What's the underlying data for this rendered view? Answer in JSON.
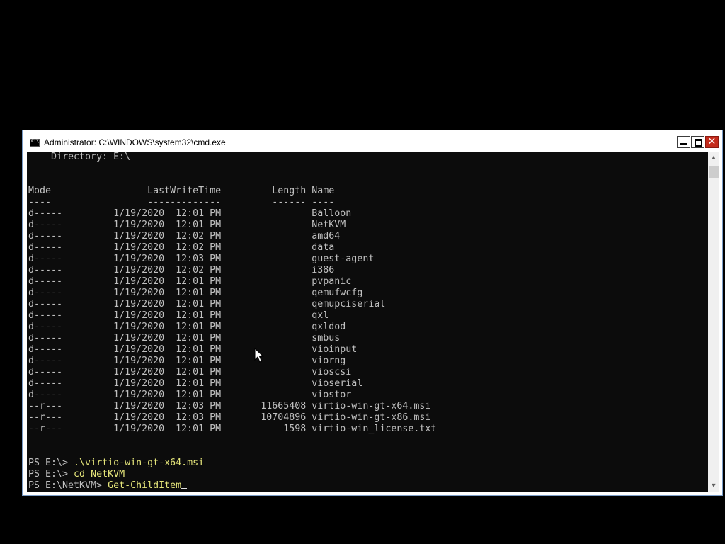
{
  "window": {
    "title": "Administrator: C:\\WINDOWS\\system32\\cmd.exe",
    "controls": {
      "minimize": "minimize",
      "maximize": "maximize",
      "close": "✕"
    }
  },
  "console": {
    "directory_header": "    Directory: E:\\",
    "columns_header": "Mode                 LastWriteTime         Length Name",
    "columns_rule": "----                 -------------         ------ ----",
    "entries": [
      "d-----         1/19/2020  12:01 PM                Balloon",
      "d-----         1/19/2020  12:01 PM                NetKVM",
      "d-----         1/19/2020  12:02 PM                amd64",
      "d-----         1/19/2020  12:02 PM                data",
      "d-----         1/19/2020  12:03 PM                guest-agent",
      "d-----         1/19/2020  12:02 PM                i386",
      "d-----         1/19/2020  12:01 PM                pvpanic",
      "d-----         1/19/2020  12:01 PM                qemufwcfg",
      "d-----         1/19/2020  12:01 PM                qemupciserial",
      "d-----         1/19/2020  12:01 PM                qxl",
      "d-----         1/19/2020  12:01 PM                qxldod",
      "d-----         1/19/2020  12:01 PM                smbus",
      "d-----         1/19/2020  12:01 PM                vioinput",
      "d-----         1/19/2020  12:01 PM                viorng",
      "d-----         1/19/2020  12:01 PM                vioscsi",
      "d-----         1/19/2020  12:01 PM                vioserial",
      "d-----         1/19/2020  12:01 PM                viostor",
      "--r---         1/19/2020  12:03 PM       11665408 virtio-win-gt-x64.msi",
      "--r---         1/19/2020  12:03 PM       10704896 virtio-win-gt-x86.msi",
      "--r---         1/19/2020  12:01 PM           1598 virtio-win_license.txt"
    ],
    "history": [
      {
        "prompt": "PS E:\\> ",
        "command": ".\\virtio-win-gt-x64.msi"
      },
      {
        "prompt": "PS E:\\> ",
        "command": "cd NetKVM"
      },
      {
        "prompt": "PS E:\\NetKVM> ",
        "command": "Get-ChildItem"
      }
    ]
  },
  "scrollbar": {
    "up_icon": "chevron-up",
    "down_icon": "chevron-down"
  },
  "colors": {
    "console_bg": "#0c0c0c",
    "console_text": "#c0c0c0",
    "command_text": "#e5e57a",
    "close_button": "#c42b1c"
  }
}
